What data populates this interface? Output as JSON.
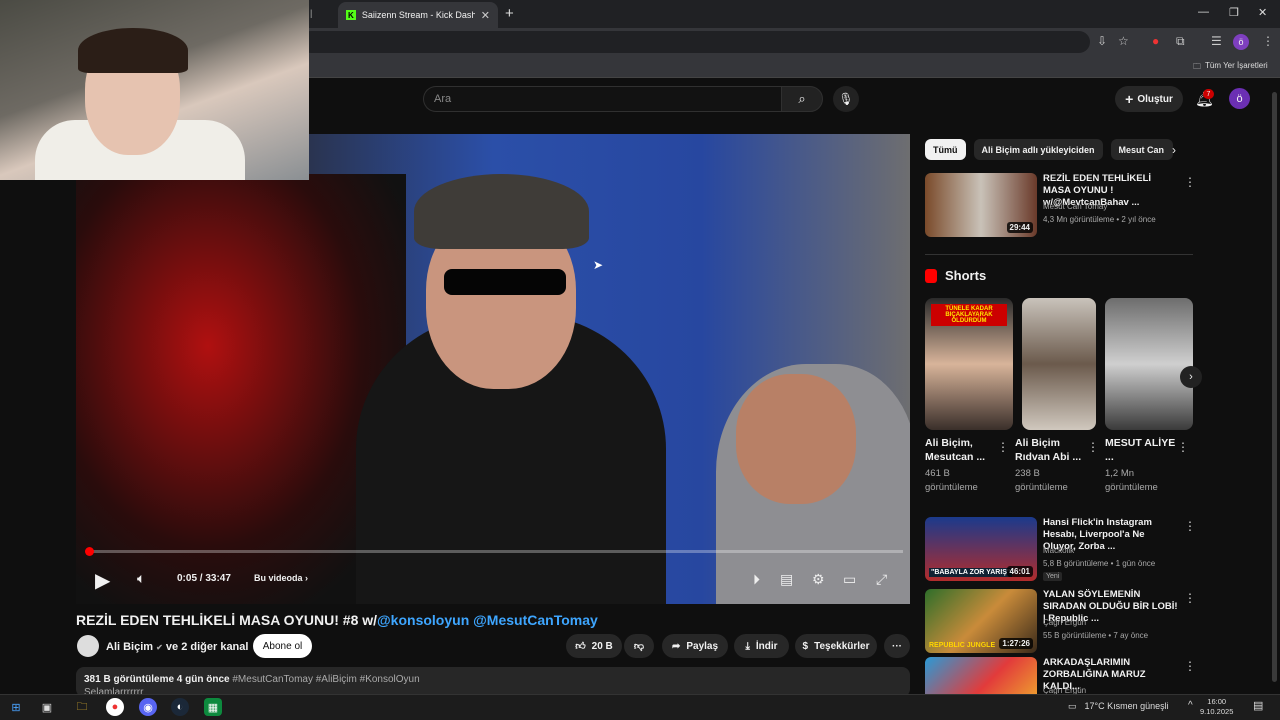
{
  "browser": {
    "tab_title": "Saiizenn Stream - Kick Dashboa",
    "tab_partial": "|",
    "new_tab": "+",
    "bookmarks_label": "Tüm Yer İşaretleri",
    "profile_initial": "ö"
  },
  "masthead": {
    "search_placeholder": "Ara",
    "create_label": "Oluştur",
    "notification_count": "7",
    "avatar_initial": "ö"
  },
  "player": {
    "time": "0:05 / 33:47",
    "chapter": "Bu videoda",
    "progress_fraction": 0.0025
  },
  "video": {
    "title_prefix": "REZİL EDEN TEHLİKELİ MASA OYUNU! #8 w/",
    "mention1": "@konsoloyun",
    "mention2": "@MesutCanTomay",
    "channel": "Ali Biçim",
    "channel_extra": "ve 2 diğer kanal",
    "subscribe": "Abone ol",
    "likes": "20 B",
    "share": "Paylaş",
    "download": "İndir",
    "thanks": "Teşekkürler",
    "more": "···",
    "desc_stats": "381 B görüntüleme  4 gün önce",
    "desc_tags": "#MesutCanTomay #AliBiçim #KonsolOyun",
    "desc_line2": "Selamlarrrrrrr"
  },
  "chips": [
    "Tümü",
    "Ali Biçim adlı yükleyiciden",
    "Mesut Can"
  ],
  "related_top": {
    "title": "REZİL EDEN TEHLİKELİ MASA OYUNU ! w/@MevtcanBahav ...",
    "channel": "Mesut Can Tomay",
    "meta": "4,3 Mn görüntüleme • 2 yıl önce",
    "duration": "29:44"
  },
  "shorts": {
    "heading": "Shorts",
    "items": [
      {
        "title": "Ali Biçim, Mesutcan ...",
        "views": "461 B görüntüleme",
        "overlay": "TÜNELE KADAR BIÇAKLAYARAK ÖLDÜRDÜM"
      },
      {
        "title": "Ali Biçim Rıdvan Abi ...",
        "views": "238 B görüntüleme",
        "overlay": ""
      },
      {
        "title": "MESUT ALİYE ...",
        "views": "1,2 Mn görüntüleme",
        "overlay": ""
      }
    ]
  },
  "related": [
    {
      "title": "Hansi Flick'in Instagram Hesabı, Liverpool'a Ne Oluyor, Zorba ...",
      "channel": "Mackolik",
      "meta": "5,8 B görüntüleme • 1 gün önce",
      "badge": "Yeni",
      "duration": "46:01",
      "thumb_text": "\"BABAYLA ZOR YARIŞ\""
    },
    {
      "title": "YALAN SÖYLEMENİN SIRADAN OLDUĞU BİR LOBİ! | Republic ...",
      "channel": "Çağrı Ergün",
      "meta": "55 B görüntüleme • 7 ay önce",
      "badge": "",
      "duration": "1:27:26",
      "thumb_text": "REPUBLIC JUNGLE"
    },
    {
      "title": "ARKADAŞLARIMIN ZORBALIĞINA MARUZ KALDI...",
      "channel": "Çağrı Ergün",
      "meta": "",
      "badge": "",
      "duration": "",
      "thumb_text": ""
    }
  ],
  "taskbar": {
    "weather": "17°C  Kısmen güneşli",
    "time": "16:00",
    "date": "9.10.2025"
  },
  "colors": {
    "accent": "#ff0000",
    "link": "#3ea6ff",
    "kick": "#53fc18"
  }
}
